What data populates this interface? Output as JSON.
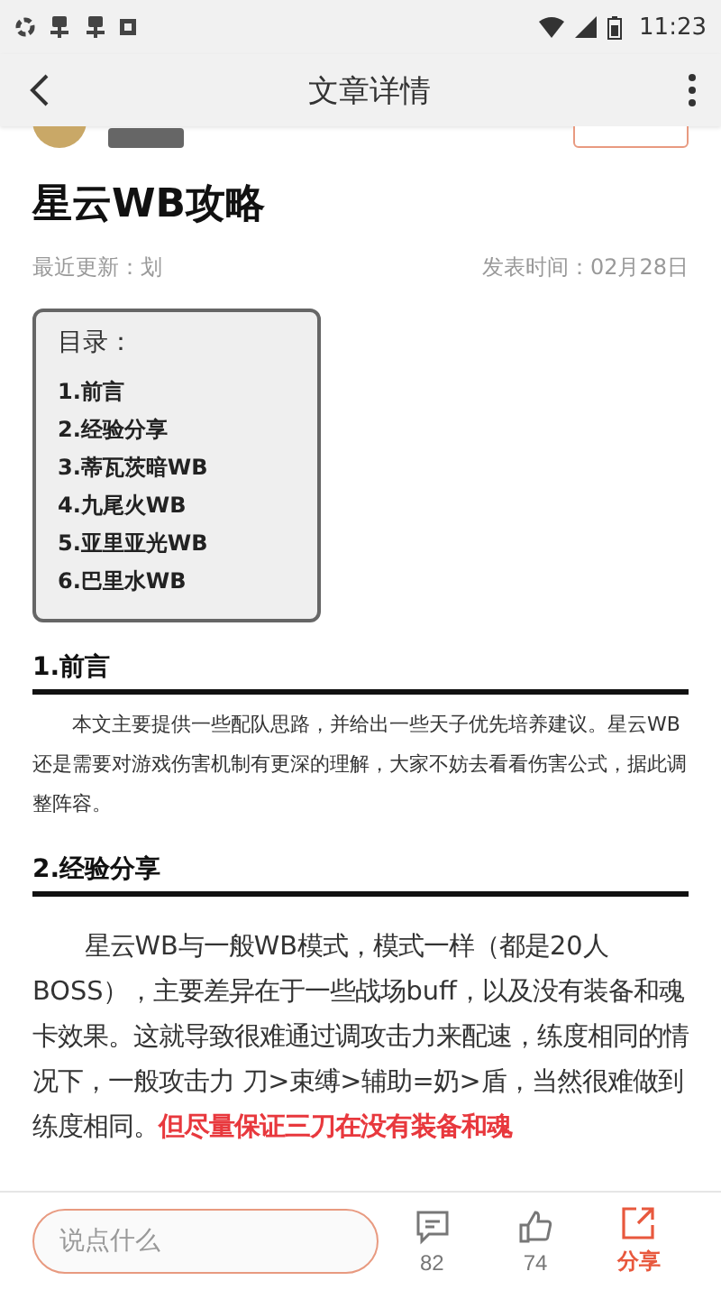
{
  "status_bar": {
    "time": "11:23"
  },
  "app_bar": {
    "title": "文章详情"
  },
  "article": {
    "title": "星云WB攻略",
    "updated": "最近更新：划",
    "published": "发表时间：02月28日",
    "toc": {
      "heading": "目录：",
      "items": [
        "1.前言",
        "2.经验分享",
        "3.蒂瓦茨暗WB",
        "4.九尾火WB",
        "5.亚里亚光WB",
        "6.巴里水WB"
      ]
    },
    "sections": [
      {
        "heading": "1.前言",
        "kind": "small",
        "text": "本文主要提供一些配队思路，并给出一些天子优先培养建议。星云WB还是需要对游戏伤害机制有更深的理解，大家不妨去看看伤害公式，据此调整阵容。"
      },
      {
        "heading": "2.经验分享",
        "kind": "large",
        "text": "星云WB与一般WB模式，模式一样（都是20人BOSS），主要差异在于一些战场buff，以及没有装备和魂卡效果。这就导致很难通过调攻击力来配速，练度相同的情况下，一般攻击力 刀>束缚>辅助=奶>盾，当然很难做到练度相同。",
        "highlight": "但尽量保证三刀在没有装备和魂"
      }
    ]
  },
  "bottom_bar": {
    "comment_placeholder": "说点什么",
    "comments": "82",
    "likes": "74",
    "share": "分享"
  }
}
